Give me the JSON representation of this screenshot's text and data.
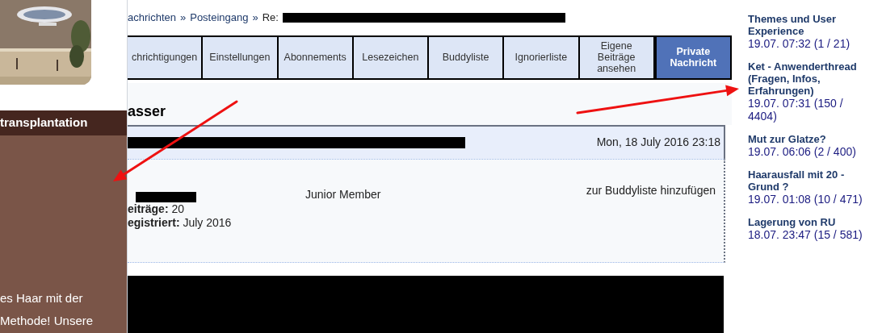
{
  "left_panel": {
    "heading": "transplantation",
    "text_lines": [
      "es Haar mit der",
      "Methode! Unsere"
    ]
  },
  "breadcrumb": {
    "items": [
      "achrichten",
      "Posteingang",
      "Re:"
    ],
    "separator": "»"
  },
  "tabs": [
    {
      "label": "chrichtigungen",
      "selected": false
    },
    {
      "label": "Einstellungen",
      "selected": false
    },
    {
      "label": "Abonnements",
      "selected": false
    },
    {
      "label": "Lesezeichen",
      "selected": false
    },
    {
      "label": "Buddyliste",
      "selected": false
    },
    {
      "label": "Ignorierliste",
      "selected": false
    },
    {
      "label": "Eigene Beiträge ansehen",
      "selected": false
    },
    {
      "label": "Private Nachricht",
      "selected": true
    }
  ],
  "post": {
    "heading": "asser",
    "date": "Mon, 18 July 2016 23:18",
    "rank": "Junior Member",
    "buddy_link": "zur Buddyliste hinzufügen",
    "stats": [
      {
        "label": "eiträge:",
        "value": "20"
      },
      {
        "label": "egistriert:",
        "value": "July 2016"
      }
    ]
  },
  "sidebar": {
    "threads": [
      {
        "title": "Themes und User Experience",
        "meta": "19.07. 07:32 (1 / 21)"
      },
      {
        "title": "Ket - Anwenderthread (Fragen, Infos, Erfahrungen)",
        "meta": "19.07. 07:31 (150 / 4404)"
      },
      {
        "title": "Mut zur Glatze?",
        "meta": "19.07. 06:06 (2 / 400)"
      },
      {
        "title": "Haarausfall mit 20 - Grund ?",
        "meta": "19.07. 01:08 (10 / 471)"
      },
      {
        "title": "Lagerung von RU",
        "meta": "18.07. 23:47 (15 / 581)"
      }
    ]
  }
}
